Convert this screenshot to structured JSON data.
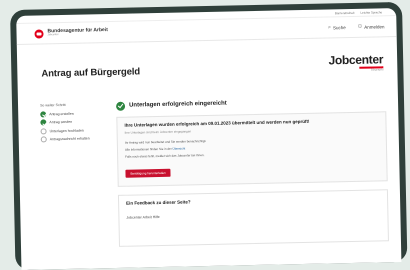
{
  "utility_links": [
    "Barrierefreiheit",
    "Leichte Sprache"
  ],
  "header": {
    "logo_title": "Bundesagentur für Arbeit",
    "logo_sub": "Jobcenter",
    "search_label": "Suche",
    "login_label": "Anmelden"
  },
  "page": {
    "title": "Antrag auf Bürgergeld",
    "brand_name": "Jobcenter",
    "brand_sub": "Bürgergeld"
  },
  "steps": {
    "heading": "So weiter Schritt",
    "items": [
      {
        "label": "Antrag erstellen",
        "done": true
      },
      {
        "label": "Antrag senden",
        "done": true
      },
      {
        "label": "Unterlagen hochladen",
        "done": false
      },
      {
        "label": "Antragsnachricht erhalten",
        "done": false
      }
    ]
  },
  "status": {
    "title": "Unterlagen erfolgreich eingereicht"
  },
  "card": {
    "title": "Ihre Unterlagen wurden erfolgreich am 09.01.2023 übermittelt und werden nun geprüft!",
    "sub": "Ihre Unterlagen sind beim Jobcenter eingegangen",
    "line1": "Ihr Antrag wird nun bearbeitet und Sie werden benachrichtigt.",
    "line2_prefix": "Alle Informationen finden Sie in der",
    "line2_link": "Übersicht",
    "line3": "Falls noch etwas fehlt, meldet sich das Jobcenter bei Ihnen.",
    "button_label": "Bestätigung herunterladen"
  },
  "feedback": {
    "title": "Ein Feedback zu dieser Seite?",
    "sub": "Jobcenter Arbeit Hilfe"
  },
  "colors": {
    "accent": "#e2001a",
    "success": "#2e8540",
    "button": "#c8102e"
  }
}
